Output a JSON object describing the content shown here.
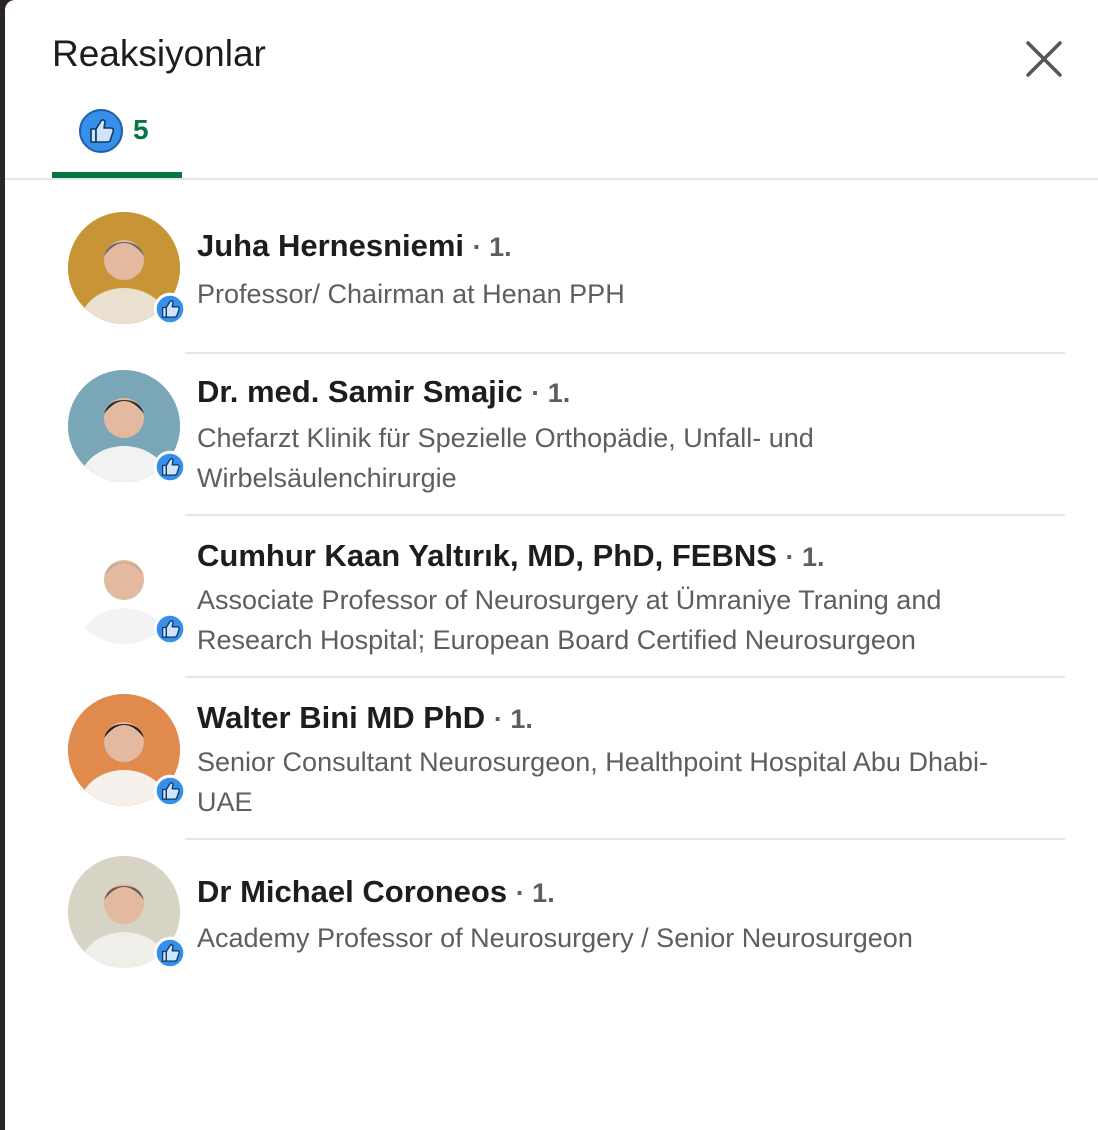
{
  "dialog": {
    "title": "Reaksiyonlar",
    "close_icon": "close-icon"
  },
  "tabs": [
    {
      "icon": "like-icon",
      "count": "5",
      "active": true
    }
  ],
  "colors": {
    "accent": "#057642",
    "like_blue": "#378fe9",
    "text": "#1d1d1d",
    "muted": "#5e5e5e"
  },
  "reactors": [
    {
      "name": "Juha Hernesniemi",
      "degree": "· 1.",
      "headline": "Professor/ Chairman at Henan PPH",
      "reaction_icon": "like-icon"
    },
    {
      "name": "Dr. med. Samir Smajic",
      "degree": "· 1.",
      "headline": "Chefarzt Klinik für Spezielle Orthopädie, Unfall- und Wirbelsäulenchirurgie",
      "reaction_icon": "like-icon"
    },
    {
      "name": "Cumhur Kaan Yaltırık, MD, PhD, FEBNS",
      "degree": "· 1.",
      "headline": "Associate Professor of Neurosurgery at Ümraniye Traning and Research Hospital; European Board Certified Neurosurgeon",
      "reaction_icon": "like-icon"
    },
    {
      "name": "Walter Bini MD PhD",
      "degree": "· 1.",
      "headline": "Senior Consultant Neurosurgeon, Healthpoint Hospital Abu Dhabi-UAE",
      "reaction_icon": "like-icon"
    },
    {
      "name": "Dr Michael Coroneos",
      "degree": "· 1.",
      "headline": "Academy Professor of Neurosurgery / Senior Neurosurgeon",
      "reaction_icon": "like-icon"
    }
  ]
}
